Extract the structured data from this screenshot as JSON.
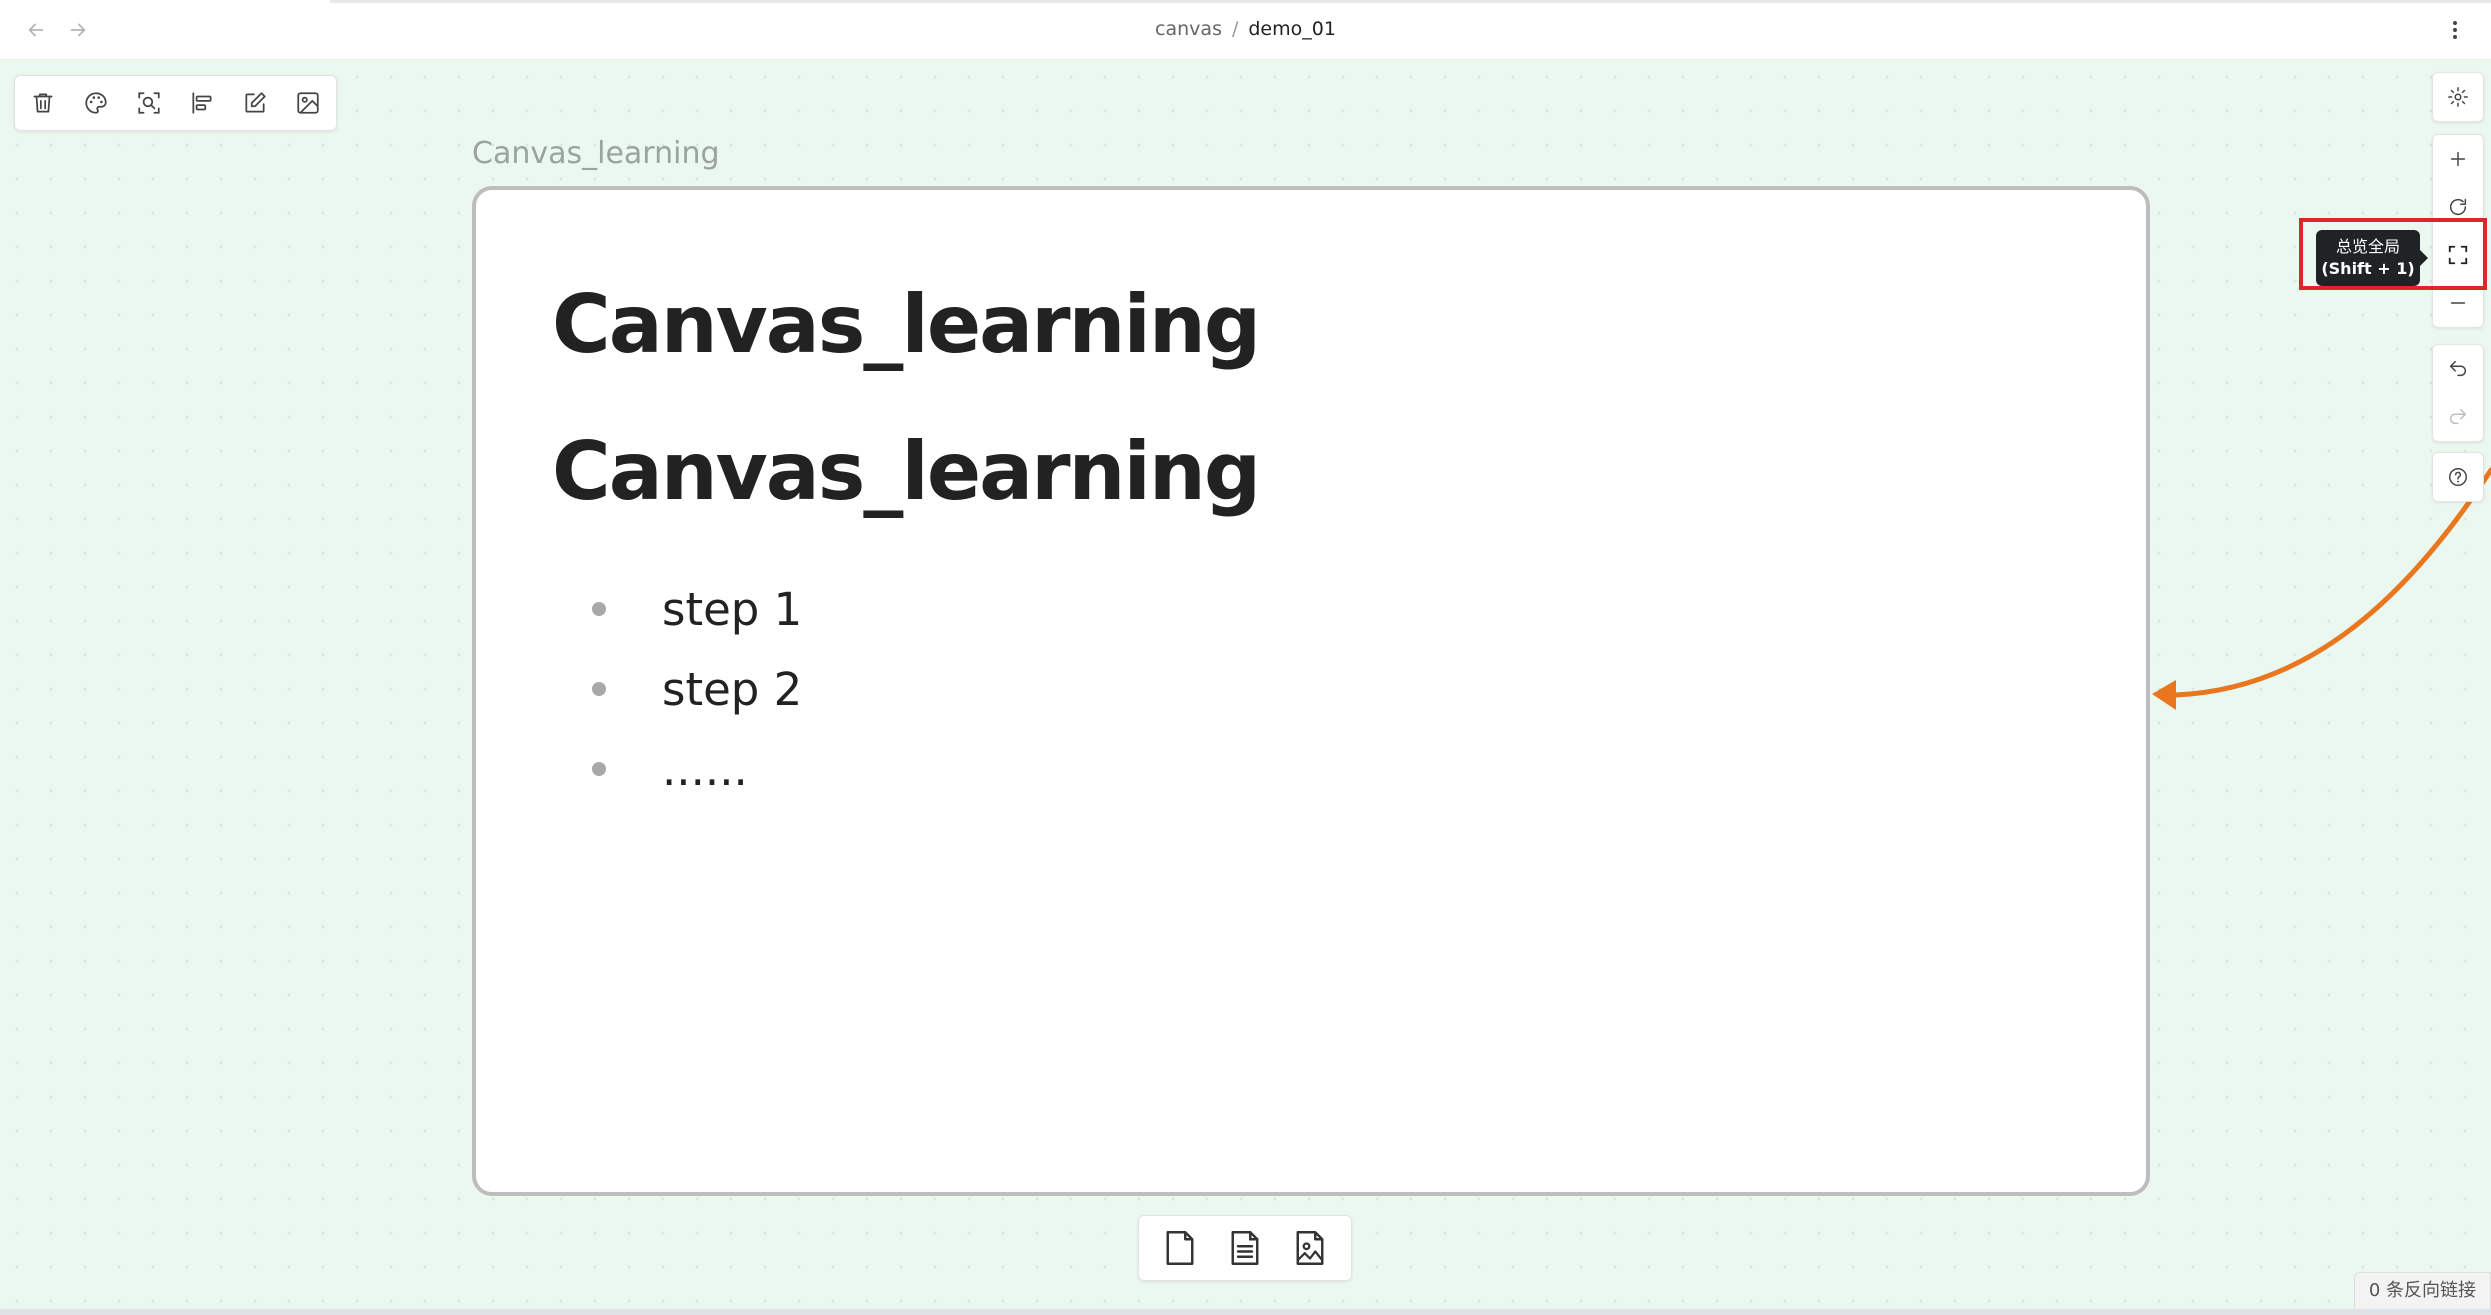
{
  "titlebar": {
    "breadcrumb_parent": "canvas",
    "breadcrumb_separator": "/",
    "breadcrumb_current": "demo_01"
  },
  "toolbar": {
    "icons": [
      "trash-icon",
      "palette-icon",
      "zoom-to-selection-icon",
      "align-icon",
      "edit-icon",
      "image-icon"
    ]
  },
  "node": {
    "label": "Canvas_learning",
    "heading_1": "Canvas_learning",
    "heading_2": "Canvas_learning",
    "list": [
      "step 1",
      "step 2",
      "......"
    ]
  },
  "controls": {
    "icons": [
      "settings-icon",
      "zoom-in-icon",
      "reset-zoom-icon",
      "zoom-to-fit-icon",
      "zoom-out-icon",
      "undo-icon",
      "redo-icon",
      "help-icon"
    ]
  },
  "tooltip": {
    "line1": "总览全局",
    "line2": "(Shift + 1)"
  },
  "card_menu": {
    "icons": [
      "new-card-icon",
      "new-note-icon",
      "add-media-icon"
    ]
  },
  "status": {
    "backlinks": "0 条反向链接"
  },
  "colors": {
    "canvas_bg": "#ebf8ef",
    "edge": "#e8771f",
    "highlight": "#e0252a"
  }
}
